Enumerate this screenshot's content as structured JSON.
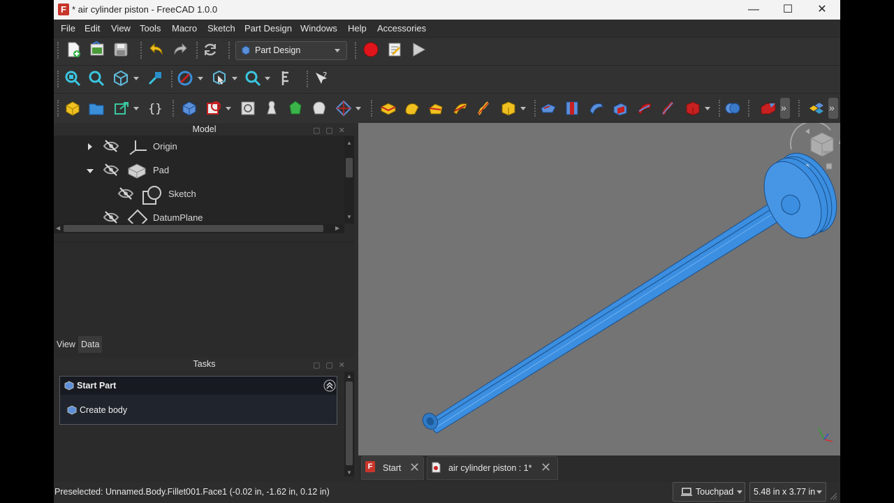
{
  "window": {
    "title": "* air cylinder piston - FreeCAD 1.0.0",
    "app_icon": "F",
    "controls": {
      "minimize": "—",
      "maximize": "☐",
      "close": "✕"
    }
  },
  "menu": [
    "File",
    "Edit",
    "View",
    "Tools",
    "Macro",
    "Sketch",
    "Part Design",
    "Windows",
    "Help",
    "Accessories"
  ],
  "toolbar": {
    "workbench": "Part Design",
    "record_color": "#e0151b",
    "more": "»"
  },
  "model_panel": {
    "title": "Model",
    "tree": [
      {
        "label": "Origin",
        "expander": "right"
      },
      {
        "label": "Pad",
        "expander": "down"
      },
      {
        "label": "Sketch",
        "expander": ""
      },
      {
        "label": "DatumPlane",
        "expander": ""
      }
    ],
    "tabs": [
      "View",
      "Data"
    ],
    "active_tab": "Data"
  },
  "tasks_panel": {
    "title": "Tasks",
    "box_title": "Start Part",
    "action": "Create body"
  },
  "view3d": {
    "background": "#747474",
    "part_color": "#3b8ee0",
    "navcube_face": "RIGHT"
  },
  "doc_tabs": [
    {
      "label": "Start",
      "close": "✕"
    },
    {
      "label": "air cylinder piston : 1*",
      "close": "✕"
    }
  ],
  "status": {
    "message": "Preselected: Unnamed.Body.Fillet001.Face1 (-0.02 in, -1.62 in, 0.12 in)",
    "nav_style": "Touchpad",
    "dimensions": "5.48 in x 3.77 in"
  }
}
